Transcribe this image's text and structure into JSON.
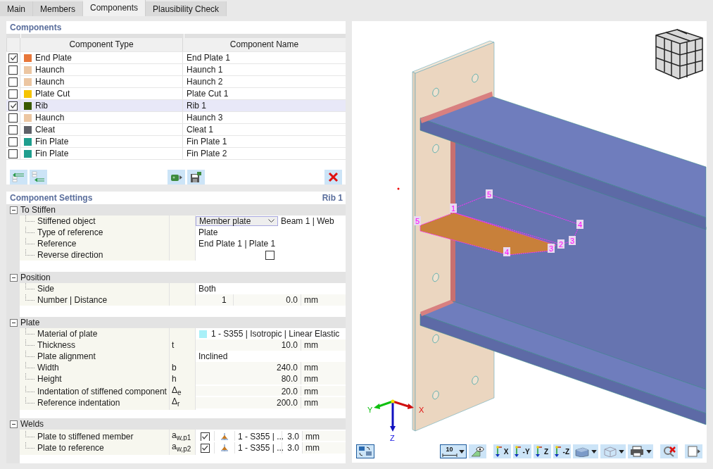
{
  "tabs": [
    {
      "label": "Main",
      "selected": false
    },
    {
      "label": "Members",
      "selected": false
    },
    {
      "label": "Components",
      "selected": true
    },
    {
      "label": "Plausibility Check",
      "selected": false
    }
  ],
  "components": {
    "title": "Components",
    "columns": [
      "Component Type",
      "Component Name"
    ],
    "rows": [
      {
        "checked": true,
        "color": "#e8773a",
        "type": "End Plate",
        "name": "End Plate 1",
        "selected": false
      },
      {
        "checked": false,
        "color": "#ecc6a2",
        "type": "Haunch",
        "name": "Haunch 1",
        "selected": false
      },
      {
        "checked": false,
        "color": "#ecc6a2",
        "type": "Haunch",
        "name": "Haunch 2",
        "selected": false
      },
      {
        "checked": false,
        "color": "#f5c400",
        "type": "Plate Cut",
        "name": "Plate Cut 1",
        "selected": false
      },
      {
        "checked": true,
        "color": "#3a5a00",
        "type": "Rib",
        "name": "Rib 1",
        "selected": true
      },
      {
        "checked": false,
        "color": "#ecc6a2",
        "type": "Haunch",
        "name": "Haunch 3",
        "selected": false
      },
      {
        "checked": false,
        "color": "#5f6168",
        "type": "Cleat",
        "name": "Cleat 1",
        "selected": false
      },
      {
        "checked": false,
        "color": "#1f9e8e",
        "type": "Fin Plate",
        "name": "Fin Plate 1",
        "selected": false
      },
      {
        "checked": false,
        "color": "#1f9e8e",
        "type": "Fin Plate",
        "name": "Fin Plate 2",
        "selected": false
      }
    ]
  },
  "settings": {
    "title": "Component Settings",
    "current": "Rib 1",
    "groups": [
      {
        "title": "To Stiffen",
        "expanded": true,
        "rows": [
          {
            "kind": "dropdown",
            "label": "Stiffened object",
            "value": "Member plate",
            "extra": "Beam 1 | Web"
          },
          {
            "kind": "text",
            "label": "Type of reference",
            "value": "Plate"
          },
          {
            "kind": "text",
            "label": "Reference",
            "value": "End Plate 1 | Plate 1"
          },
          {
            "kind": "checkbox",
            "label": "Reverse direction",
            "checked": false
          }
        ]
      },
      {
        "title": "Position",
        "expanded": true,
        "rows": [
          {
            "kind": "text",
            "label": "Side",
            "value": "Both"
          },
          {
            "kind": "count_distance",
            "label": "Number | Distance",
            "count": "1",
            "value": "0.0",
            "unit": "mm"
          }
        ]
      },
      {
        "title": "Plate",
        "expanded": true,
        "rows": [
          {
            "kind": "material",
            "label": "Material of plate",
            "color": "#a8f0f8",
            "value": "1 - S355 | Isotropic | Linear Elastic"
          },
          {
            "kind": "number",
            "label": "Thickness",
            "symbol": "t",
            "value": "10.0",
            "unit": "mm"
          },
          {
            "kind": "text",
            "label": "Plate alignment",
            "value": "Inclined"
          },
          {
            "kind": "number",
            "label": "Width",
            "symbol": "b",
            "value": "240.0",
            "unit": "mm"
          },
          {
            "kind": "number",
            "label": "Height",
            "symbol": "h",
            "value": "80.0",
            "unit": "mm"
          },
          {
            "kind": "number",
            "label": "Indentation of stiffened component",
            "symbol": "Δ$_{e}$",
            "value": "20.0",
            "unit": "mm"
          },
          {
            "kind": "number",
            "label": "Reference indentation",
            "symbol": "Δ$_{r}$",
            "value": "200.0",
            "unit": "mm"
          }
        ]
      },
      {
        "title": "Welds",
        "expanded": true,
        "rows": [
          {
            "kind": "weld",
            "label": "Plate to stiffened member",
            "symbol": "a$_{w,p1}$",
            "checked": true,
            "material": "1 - S355 | ...",
            "value": "3.0",
            "unit": "mm"
          },
          {
            "kind": "weld",
            "label": "Plate to reference",
            "symbol": "a$_{w,p2}$",
            "checked": true,
            "material": "1 - S355 | ...",
            "value": "3.0",
            "unit": "mm"
          }
        ]
      }
    ]
  },
  "viewport": {
    "node_labels": [
      "5",
      "1",
      "5",
      "4",
      "3",
      "2",
      "3",
      "4"
    ],
    "axes": {
      "x": "X",
      "y": "Y",
      "z": "Z"
    },
    "toolbar": {
      "scale": "10",
      "views": [
        "X",
        "-Y",
        "Z",
        "-Z"
      ]
    }
  }
}
